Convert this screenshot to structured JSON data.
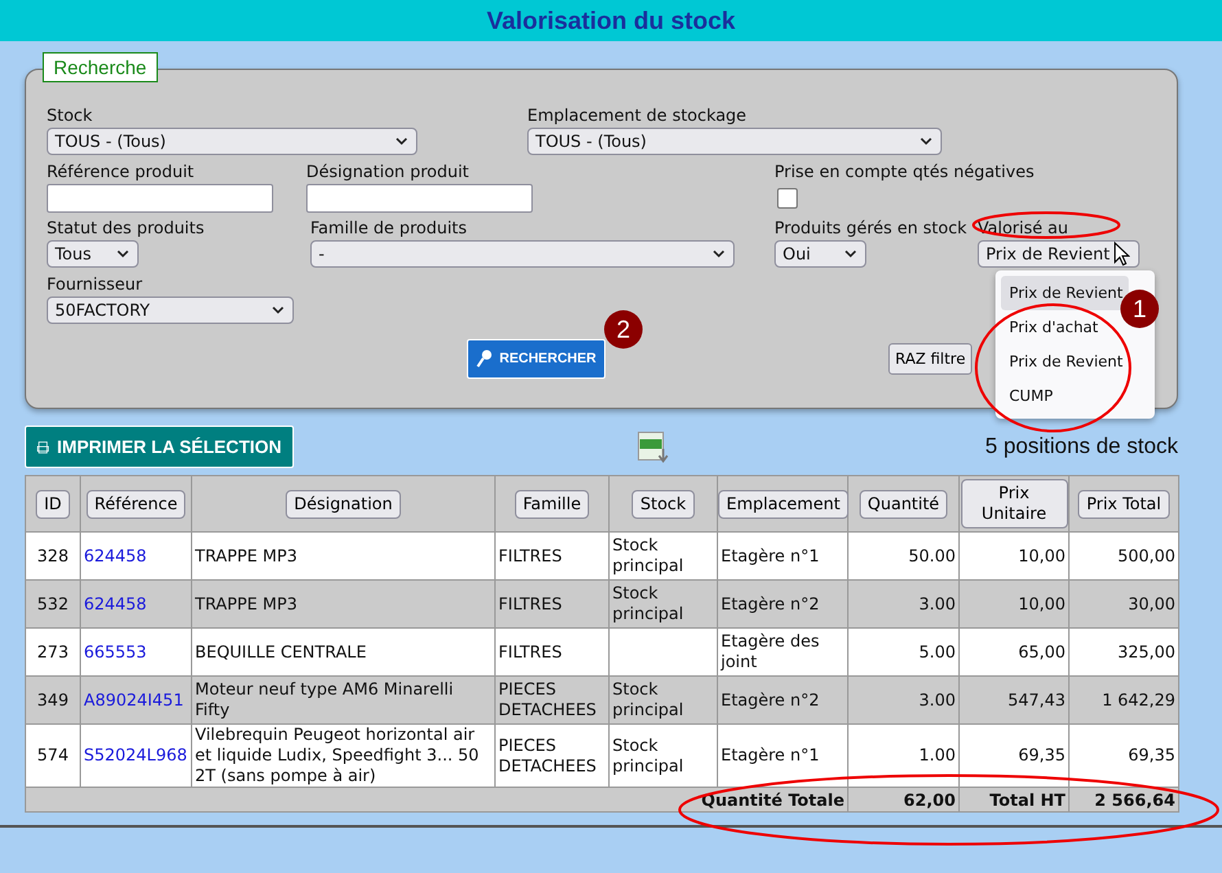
{
  "page_title": "Valorisation du stock",
  "search_panel": {
    "legend": "Recherche",
    "stock": {
      "label": "Stock",
      "value": "TOUS - (Tous)"
    },
    "location": {
      "label": "Emplacement de stockage",
      "value": "TOUS - (Tous)"
    },
    "reference": {
      "label": "Référence produit"
    },
    "designation": {
      "label": "Désignation produit"
    },
    "negative_qty": {
      "label": "Prise en compte qtés négatives",
      "checked": false
    },
    "status": {
      "label": "Statut des produits",
      "value": "Tous"
    },
    "family": {
      "label": "Famille de produits",
      "value": "-"
    },
    "managed": {
      "label": "Produits gérés en stock",
      "value": "Oui"
    },
    "valued_at": {
      "label": "Valorisé au",
      "value": "Prix de Revient",
      "expanded": true,
      "options": [
        {
          "label": "Prix de Revient",
          "highlighted": true
        },
        {
          "label": "Prix d'achat",
          "highlighted": false
        },
        {
          "label": "Prix de Revient",
          "highlighted": false
        },
        {
          "label": "CUMP",
          "highlighted": false
        }
      ]
    },
    "supplier": {
      "label": "Fournisseur",
      "value": "50FACTORY"
    },
    "search_button": "RECHERCHER",
    "reset_button": "RAZ filtre"
  },
  "annotations": [
    {
      "number": "1"
    },
    {
      "number": "2"
    }
  ],
  "print_button": "IMPRIMER LA SÉLECTION",
  "count": "5 positions de stock",
  "table": {
    "columns": [
      "ID",
      "Référence",
      "Désignation",
      "Famille",
      "Stock",
      "Emplacement",
      "Quantité",
      "Prix Unitaire",
      "Prix Total"
    ],
    "rows": [
      [
        "328",
        "624458",
        "TRAPPE MP3",
        "FILTRES",
        "Stock principal",
        "Etagère n°1",
        "50.00",
        "10,00",
        "500,00"
      ],
      [
        "532",
        "624458",
        "TRAPPE MP3",
        "FILTRES",
        "Stock principal",
        "Etagère n°2",
        "3.00",
        "10,00",
        "30,00"
      ],
      [
        "273",
        "665553",
        "BEQUILLE CENTRALE",
        "FILTRES",
        "",
        "Etagère des joint",
        "5.00",
        "65,00",
        "325,00"
      ],
      [
        "349",
        "A89024I451",
        "Moteur neuf type AM6 Minarelli Fifty",
        "PIECES DETACHEES",
        "Stock principal",
        "Etagère n°2",
        "3.00",
        "547,43",
        "1 642,29"
      ],
      [
        "574",
        "S52024L968",
        "Vilebrequin Peugeot horizontal air et liquide Ludix, Speedfight 3... 50 2T (sans pompe à air)",
        "PIECES DETACHEES",
        "Stock principal",
        "Etagère n°1",
        "1.00",
        "69,35",
        "69,35"
      ]
    ],
    "footer": {
      "qty_label": "Quantité Totale",
      "qty": "62,00",
      "total_label": "Total HT",
      "total": "2 566,64"
    }
  }
}
